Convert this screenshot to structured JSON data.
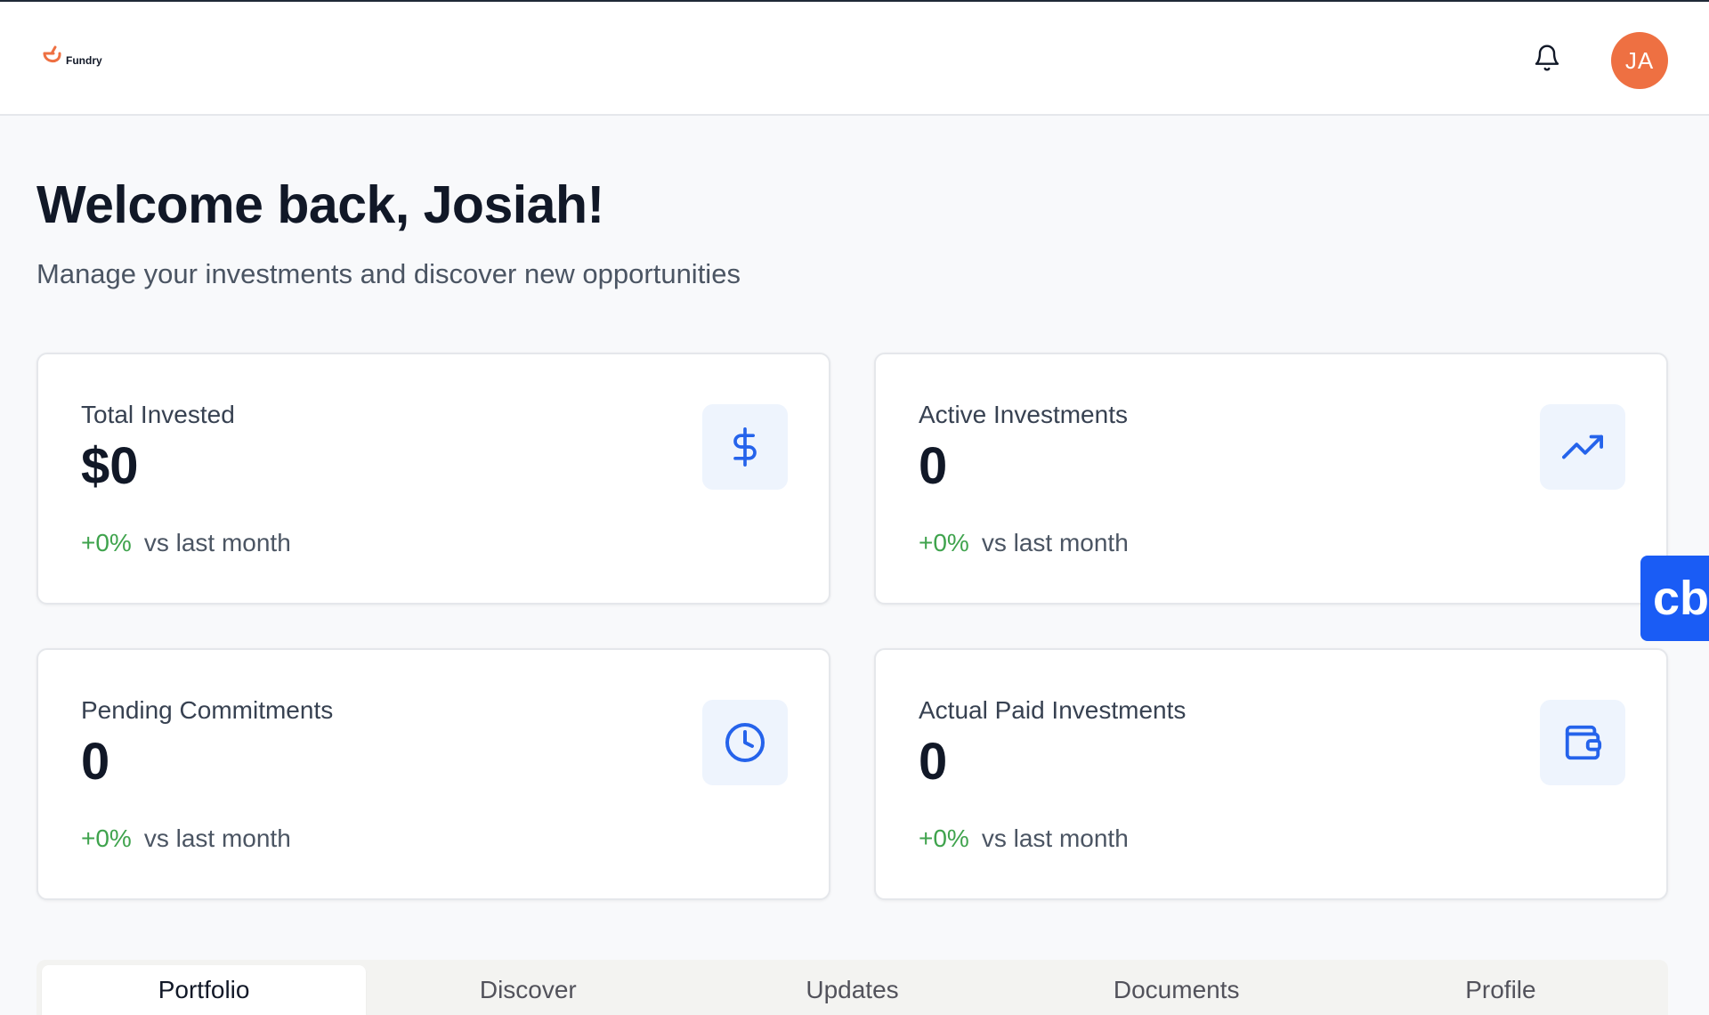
{
  "app": {
    "brand_name": "Fundry",
    "brand_color": "#ee7042"
  },
  "header": {
    "bell_icon": "bell-icon",
    "avatar_initials": "JA",
    "avatar_color": "#ee7042"
  },
  "main": {
    "title": "Welcome back, Josiah!",
    "subtitle": "Manage your investments and discover new opportunities"
  },
  "stats": [
    {
      "label": "Total Invested",
      "value": "$0",
      "change_pct": "+0%",
      "change_text": "vs last month",
      "icon": "dollar-icon"
    },
    {
      "label": "Active Investments",
      "value": "0",
      "change_pct": "+0%",
      "change_text": "vs last month",
      "icon": "trending-up-icon"
    },
    {
      "label": "Pending Commitments",
      "value": "0",
      "change_pct": "+0%",
      "change_text": "vs last month",
      "icon": "clock-icon"
    },
    {
      "label": "Actual Paid Investments",
      "value": "0",
      "change_pct": "+0%",
      "change_text": "vs last month",
      "icon": "wallet-icon"
    }
  ],
  "colors": {
    "accent": "#2563eb",
    "positive": "#3fa34d",
    "icon_bg": "#eef4fd"
  },
  "widget": {
    "label": "cb"
  },
  "tabs": [
    {
      "label": "Portfolio",
      "active": true
    },
    {
      "label": "Discover"
    },
    {
      "label": "Updates"
    },
    {
      "label": "Documents"
    },
    {
      "label": "Profile"
    }
  ]
}
